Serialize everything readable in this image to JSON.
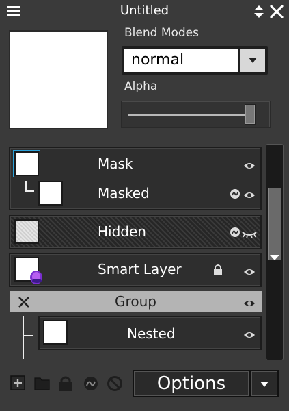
{
  "window": {
    "title": "Untitled"
  },
  "blend": {
    "label": "Blend Modes",
    "value": "normal"
  },
  "alpha": {
    "label": "Alpha",
    "value": 0.95
  },
  "layers": {
    "mask": {
      "name": "Mask"
    },
    "masked": {
      "name": "Masked"
    },
    "hidden": {
      "name": "Hidden"
    },
    "smart": {
      "name": "Smart Layer"
    },
    "group": {
      "name": "Group"
    },
    "nested": {
      "name": "Nested"
    }
  },
  "toolbar": {
    "options_label": "Options"
  },
  "colors": {
    "background": "#3a3a3a",
    "group_header": "#b4b4b4",
    "focus_corner": "#2aa0d8"
  }
}
